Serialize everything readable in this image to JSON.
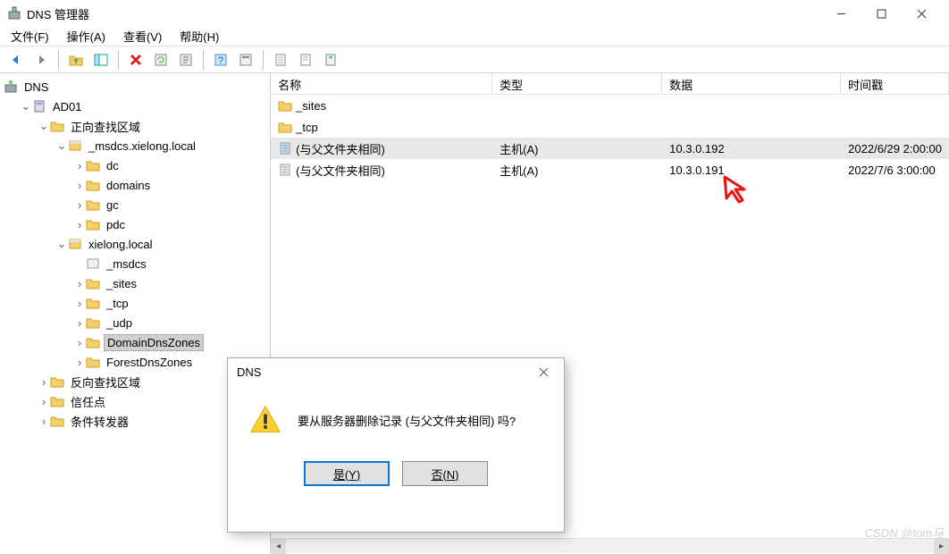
{
  "window": {
    "title": "DNS 管理器"
  },
  "menu": {
    "file": "文件(F)",
    "action": "操作(A)",
    "view": "查看(V)",
    "help": "帮助(H)"
  },
  "tree": {
    "root": "DNS",
    "server": "AD01",
    "fwd_zone": "正向查找区域",
    "msdcs": "_msdcs.xielong.local",
    "msdcs_children": {
      "dc": "dc",
      "domains": "domains",
      "gc": "gc",
      "pdc": "pdc"
    },
    "domain": "xielong.local",
    "domain_children": {
      "msdcs": "_msdcs",
      "sites": "_sites",
      "tcp": "_tcp",
      "udp": "_udp",
      "ddz": "DomainDnsZones",
      "fdz": "ForestDnsZones"
    },
    "rev_zone": "反向查找区域",
    "trust": "信任点",
    "cond": "条件转发器"
  },
  "list": {
    "col_name": "名称",
    "col_type": "类型",
    "col_data": "数据",
    "col_ts": "时间戳",
    "rows": [
      {
        "name": "_sites",
        "type": "",
        "data": "",
        "ts": ""
      },
      {
        "name": "_tcp",
        "type": "",
        "data": "",
        "ts": ""
      },
      {
        "name": "(与父文件夹相同)",
        "type": "主机(A)",
        "data": "10.3.0.192",
        "ts": "2022/6/29 2:00:00"
      },
      {
        "name": "(与父文件夹相同)",
        "type": "主机(A)",
        "data": "10.3.0.191",
        "ts": "2022/7/6 3:00:00"
      }
    ]
  },
  "dialog": {
    "title": "DNS",
    "message": "要从服务器删除记录 (与父文件夹相同) 吗?",
    "yes": "是(Y)",
    "no": "否(N)"
  },
  "watermark": "CSDN @tom马"
}
